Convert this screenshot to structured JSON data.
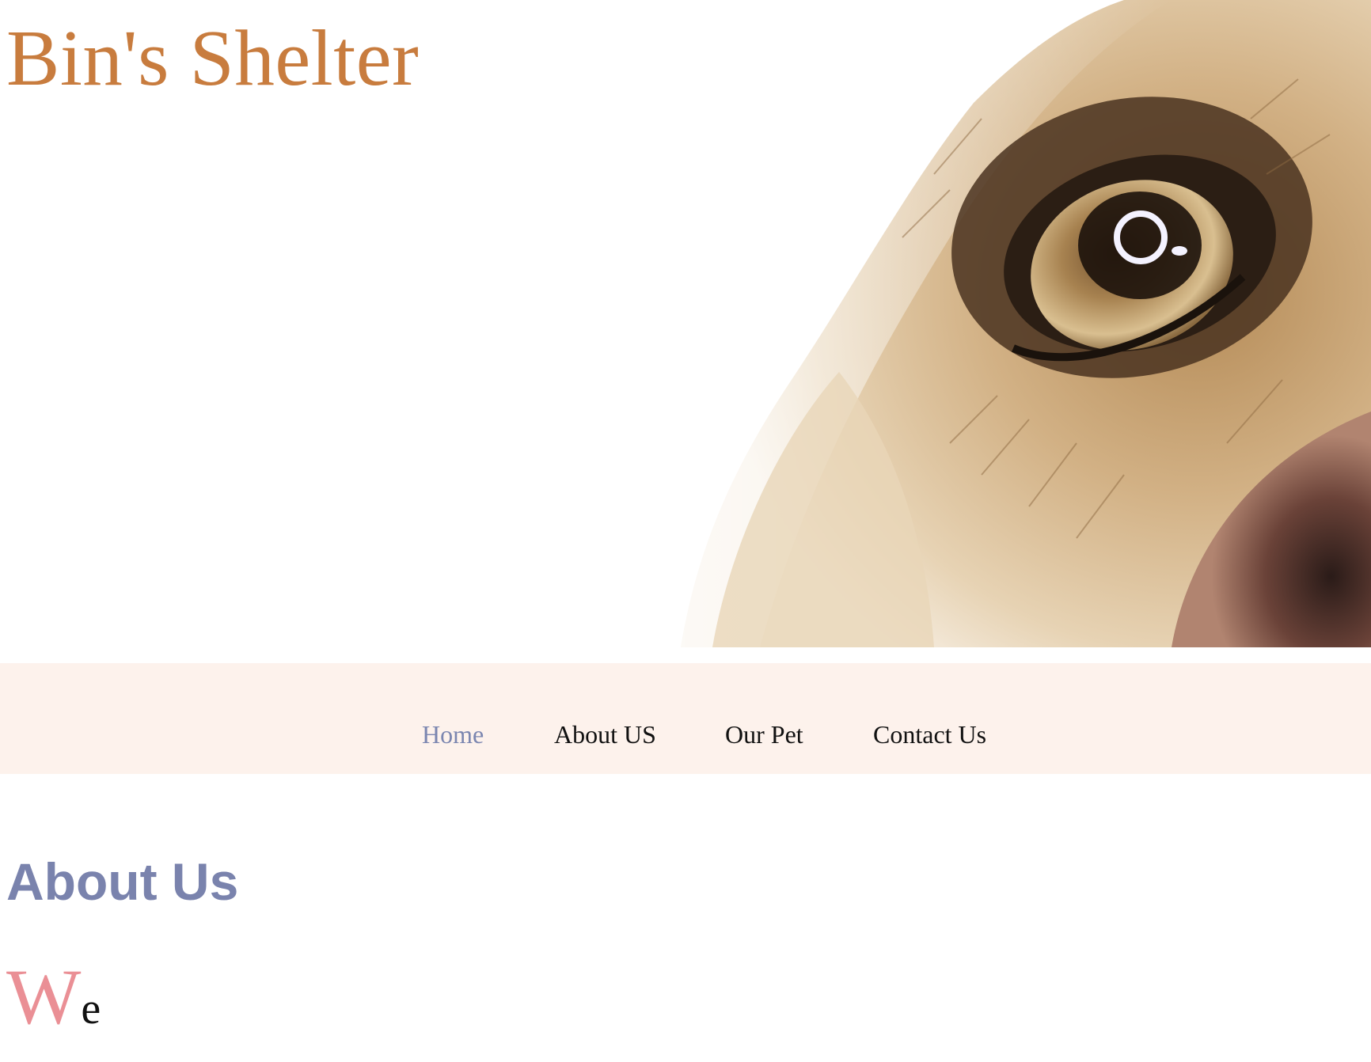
{
  "site": {
    "title": "Bin's Shelter",
    "title_color": "#c87c3e"
  },
  "hero": {
    "image": "dog-eye-closeup"
  },
  "nav": {
    "background": "#fdf2ec",
    "active_color": "#7b86b0",
    "items": [
      {
        "label": "Home",
        "active": true
      },
      {
        "label": "About US",
        "active": false
      },
      {
        "label": "Our Pet",
        "active": false
      },
      {
        "label": "Contact Us",
        "active": false
      }
    ]
  },
  "about": {
    "heading": "About Us",
    "heading_color": "#7a83ad",
    "dropcap": "W",
    "dropcap_color": "#ea8f95",
    "text_start": "e"
  }
}
